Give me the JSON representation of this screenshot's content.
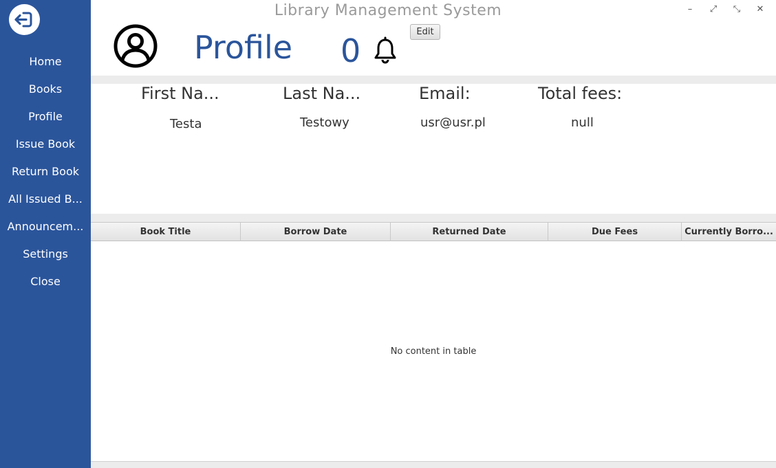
{
  "window": {
    "title": "Library Management System",
    "controls": {
      "minimize": "–",
      "restore": "⤢",
      "shrink": "⤡",
      "close": "✕"
    }
  },
  "sidebar": {
    "logout_icon": "logout-arrow-icon",
    "items": [
      {
        "label": "Home"
      },
      {
        "label": "Books"
      },
      {
        "label": "Profile"
      },
      {
        "label": "Issue Book"
      },
      {
        "label": "Return Book"
      },
      {
        "label": "All Issued B..."
      },
      {
        "label": "Announcem..."
      },
      {
        "label": "Settings"
      },
      {
        "label": "Close"
      }
    ]
  },
  "header": {
    "avatar_icon": "user-avatar-icon",
    "title": "Profile",
    "notification_count": "0",
    "bell_icon": "bell-icon",
    "edit_label": "Edit"
  },
  "user_info": {
    "first_name_label": "First Na...",
    "last_name_label": "Last Na...",
    "email_label": "Email:",
    "fees_label": "Total fees:",
    "first_name": "Testa",
    "last_name": "Testowy",
    "email": "usr@usr.pl",
    "fees": "null"
  },
  "table": {
    "columns": [
      "Book Title",
      "Borrow Date",
      "Returned Date",
      "Due Fees",
      "Currently Borro..."
    ],
    "rows": [],
    "empty_message": "No content in table"
  },
  "colors": {
    "sidebar": "#2b559b",
    "accent": "#2b559b",
    "title_gray": "#9a9a9a"
  }
}
